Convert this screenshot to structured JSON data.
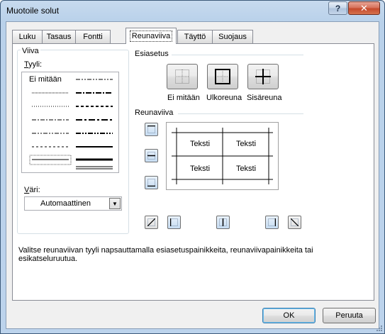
{
  "window": {
    "title": "Muotoile solut",
    "help_label": "?",
    "close_label": "✕"
  },
  "tabs": [
    {
      "label": "Luku"
    },
    {
      "label": "Tasaus"
    },
    {
      "label": "Fontti"
    },
    {
      "label": "Reunaviiva",
      "active": true
    },
    {
      "label": "Täyttö"
    },
    {
      "label": "Suojaus"
    }
  ],
  "line_group": {
    "title": "Viiva",
    "style_label": "Tyyli:",
    "style_none": "Ei mitään",
    "color_label": "Väri:",
    "color_value": "Automaattinen"
  },
  "presets": {
    "title": "Esiasetus",
    "items": [
      {
        "label": "Ei mitään",
        "icon": "border-none-icon"
      },
      {
        "label": "Ulkoreuna",
        "icon": "border-outline-icon"
      },
      {
        "label": "Sisäreuna",
        "icon": "border-inside-icon"
      }
    ]
  },
  "border": {
    "title": "Reunaviiva",
    "preview_cells": [
      "Teksti",
      "Teksti",
      "Teksti",
      "Teksti"
    ]
  },
  "hint": "Valitse reunaviivan tyyli napsauttamalla esiasetuspainikkeita, reunaviivapainikkeita tai esikatseluruutua.",
  "buttons": {
    "ok": "OK",
    "cancel": "Peruuta"
  },
  "colors": {
    "title_bar": "#b9d1ea",
    "dialog_bg": "#f0f0f0",
    "close_red": "#c54a2c",
    "accent_blue": "#3c7fb1"
  }
}
